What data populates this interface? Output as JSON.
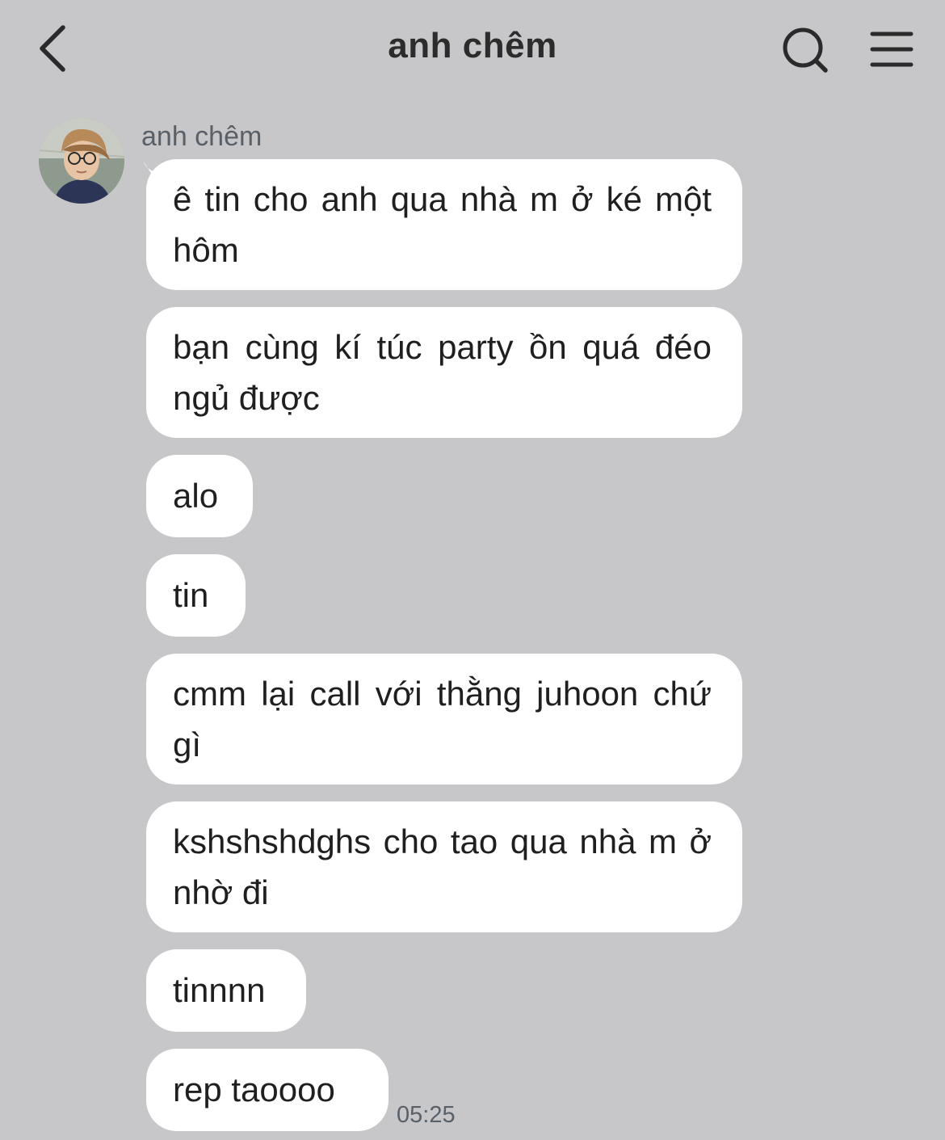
{
  "header": {
    "title": "anh chêm",
    "back_icon": "chevron-left-icon",
    "search_icon": "search-icon",
    "menu_icon": "hamburger-menu-icon"
  },
  "chat": {
    "sender_name": "anh chêm",
    "messages": [
      {
        "text": "ê tin cho anh qua nhà m ở ké một hôm"
      },
      {
        "text": "bạn cùng kí túc party ồn quá đéo ngủ được"
      },
      {
        "text": "alo"
      },
      {
        "text": "tin"
      },
      {
        "text": "cmm lại call với thằng juhoon chứ gì"
      },
      {
        "text": "kshshshdghs cho tao qua nhà m ở nhờ đi"
      },
      {
        "text": "tinnnn"
      },
      {
        "text": "rep taoooo"
      }
    ],
    "last_timestamp": "05:25"
  },
  "colors": {
    "background": "#c7c7c9",
    "bubble": "#ffffff",
    "text": "#1f1f1f",
    "secondary_text": "#5a6068"
  }
}
